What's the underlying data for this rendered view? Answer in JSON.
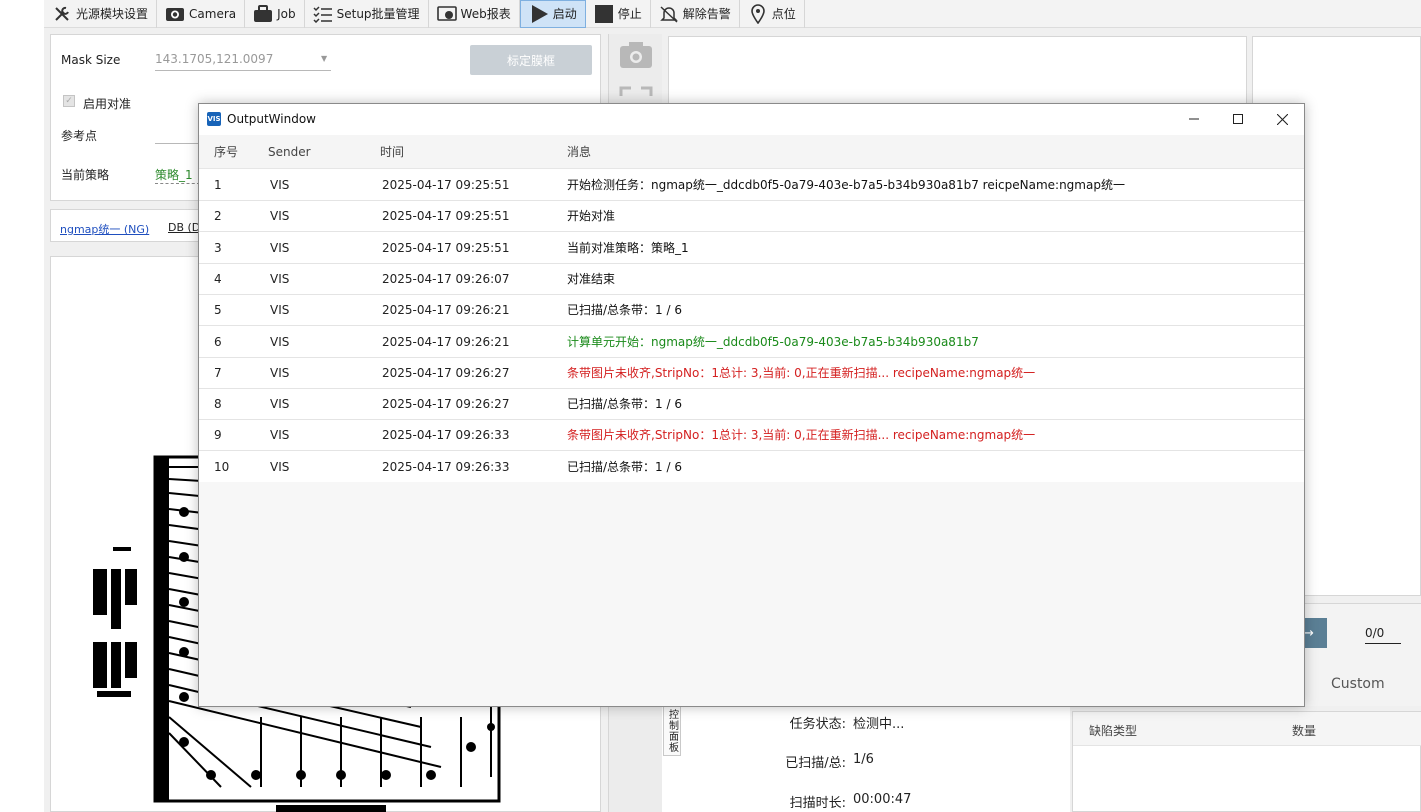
{
  "toolbar": {
    "items": [
      {
        "label": "光源模块设置",
        "icon": "tools-icon"
      },
      {
        "label": "Camera",
        "icon": "camera-icon"
      },
      {
        "label": "Job",
        "icon": "briefcase-icon"
      },
      {
        "label": "Setup批量管理",
        "icon": "checklist-icon"
      },
      {
        "label": "Web报表",
        "icon": "web-report-icon"
      },
      {
        "label": "启动",
        "icon": "play-icon"
      },
      {
        "label": "停止",
        "icon": "stop-icon"
      },
      {
        "label": "解除告警",
        "icon": "bell-off-icon"
      },
      {
        "label": "点位",
        "icon": "location-pin-icon"
      }
    ]
  },
  "settings": {
    "mask_size_label": "Mask Size",
    "mask_size_value": "143.1705,121.0097",
    "calibrate_button": "标定膜框",
    "enable_align_label": "启用对准",
    "reference_point_label": "参考点",
    "current_strategy_label": "当前策略",
    "current_strategy_value": "策略_1"
  },
  "recipe_tabs": {
    "tab1": "ngmap统一 (NG)",
    "tab2": "DB (D"
  },
  "right_panel": {
    "counter": "0/0",
    "custom_label": "Custom"
  },
  "control_panel": {
    "tab_label": "控制面板",
    "task_status_label": "任务状态:",
    "task_status_value": "检测中...",
    "scanned_label": "已扫描/总:",
    "scanned_value": "1/6",
    "scan_time_label": "扫描时长:",
    "scan_time_value": "00:00:47"
  },
  "defect_table": {
    "col_type": "缺陷类型",
    "col_count": "数量"
  },
  "output_window": {
    "title": "OutputWindow",
    "logo_text": "VIS",
    "columns": {
      "index": "序号",
      "sender": "Sender",
      "time": "时间",
      "message": "消息"
    },
    "colors": {
      "normal": "#111111",
      "green": "#1a8a1a",
      "red": "#d42020"
    },
    "rows": [
      {
        "index": "1",
        "sender": "VIS",
        "time": "2025-04-17 09:25:51",
        "message": "开始检测任务：ngmap统一_ddcdb0f5-0a79-403e-b7a5-b34b930a81b7 reicpeName:ngmap统一",
        "level": "normal"
      },
      {
        "index": "2",
        "sender": "VIS",
        "time": "2025-04-17 09:25:51",
        "message": "开始对准",
        "level": "normal"
      },
      {
        "index": "3",
        "sender": "VIS",
        "time": "2025-04-17 09:25:51",
        "message": "当前对准策略：策略_1",
        "level": "normal"
      },
      {
        "index": "4",
        "sender": "VIS",
        "time": "2025-04-17 09:26:07",
        "message": "对准结束",
        "level": "normal"
      },
      {
        "index": "5",
        "sender": "VIS",
        "time": "2025-04-17 09:26:21",
        "message": "已扫描/总条带：1 / 6",
        "level": "normal"
      },
      {
        "index": "6",
        "sender": "VIS",
        "time": "2025-04-17 09:26:21",
        "message": "计算单元开始：ngmap统一_ddcdb0f5-0a79-403e-b7a5-b34b930a81b7",
        "level": "green"
      },
      {
        "index": "7",
        "sender": "VIS",
        "time": "2025-04-17 09:26:27",
        "message": "条带图片未收齐,StripNo：1总计: 3,当前: 0,正在重新扫描... recipeName:ngmap统一",
        "level": "red"
      },
      {
        "index": "8",
        "sender": "VIS",
        "time": "2025-04-17 09:26:27",
        "message": "已扫描/总条带：1 / 6",
        "level": "normal"
      },
      {
        "index": "9",
        "sender": "VIS",
        "time": "2025-04-17 09:26:33",
        "message": "条带图片未收齐,StripNo：1总计: 3,当前: 0,正在重新扫描... recipeName:ngmap统一",
        "level": "red"
      },
      {
        "index": "10",
        "sender": "VIS",
        "time": "2025-04-17 09:26:33",
        "message": "已扫描/总条带：1 / 6",
        "level": "normal"
      }
    ]
  }
}
